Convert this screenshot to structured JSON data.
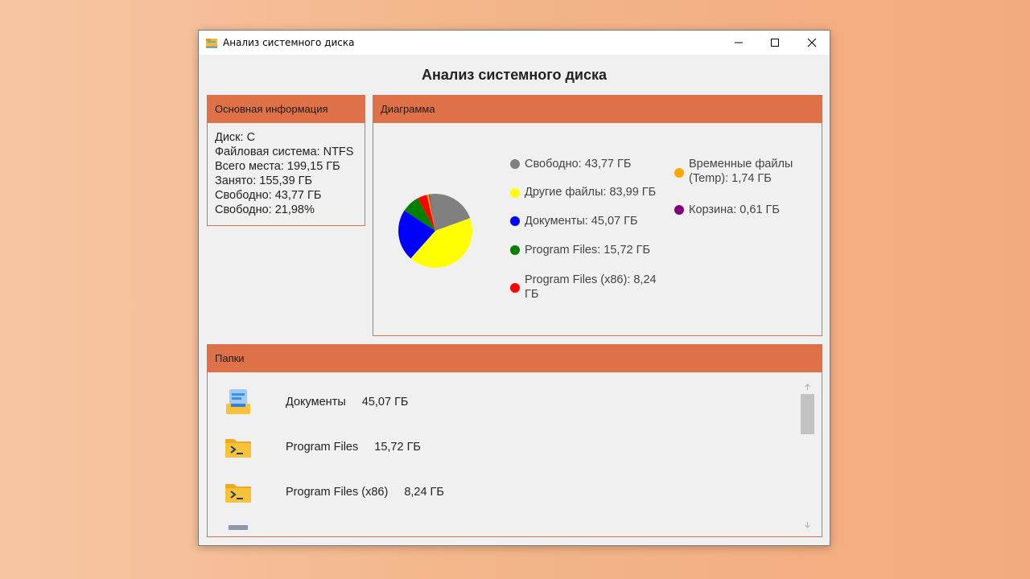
{
  "window": {
    "title": "Анализ системного диска"
  },
  "main": {
    "title": "Анализ системного диска"
  },
  "info_panel": {
    "header": "Основная информация",
    "lines": [
      "Диск: C",
      "Файловая система: NTFS",
      "Всего места: 199,15 ГБ",
      "Занято: 155,39 ГБ",
      "Свободно: 43,77 ГБ",
      "Свободно: 21,98%"
    ]
  },
  "chart_panel": {
    "header": "Диаграмма"
  },
  "chart_data": {
    "type": "pie",
    "slices": [
      {
        "label": "Свободно: 43,77 ГБ",
        "value": 43.77,
        "color": "#808080"
      },
      {
        "label": "Другие файлы: 83,99 ГБ",
        "value": 83.99,
        "color": "#ffff00"
      },
      {
        "label": "Документы: 45,07 ГБ",
        "value": 45.07,
        "color": "#0000ff"
      },
      {
        "label": "Program Files: 15,72 ГБ",
        "value": 15.72,
        "color": "#008000"
      },
      {
        "label": "Program Files (x86): 8,24 ГБ",
        "value": 8.24,
        "color": "#ff0000"
      },
      {
        "label": "Временные файлы (Temp): 1,74 ГБ",
        "value": 1.74,
        "color": "#ffa500"
      },
      {
        "label": "Корзина: 0,61 ГБ",
        "value": 0.61,
        "color": "#800080"
      }
    ]
  },
  "folders_panel": {
    "header": "Папки",
    "items": [
      {
        "name": "Документы",
        "size": "45,07 ГБ",
        "icon": "documents-folder-icon"
      },
      {
        "name": "Program Files",
        "size": "15,72 ГБ",
        "icon": "terminal-folder-icon"
      },
      {
        "name": "Program Files (x86)",
        "size": "8,24 ГБ",
        "icon": "terminal-folder-icon"
      }
    ]
  },
  "colors": {
    "accent": "#df7149",
    "window_bg": "#f0f0f0"
  }
}
